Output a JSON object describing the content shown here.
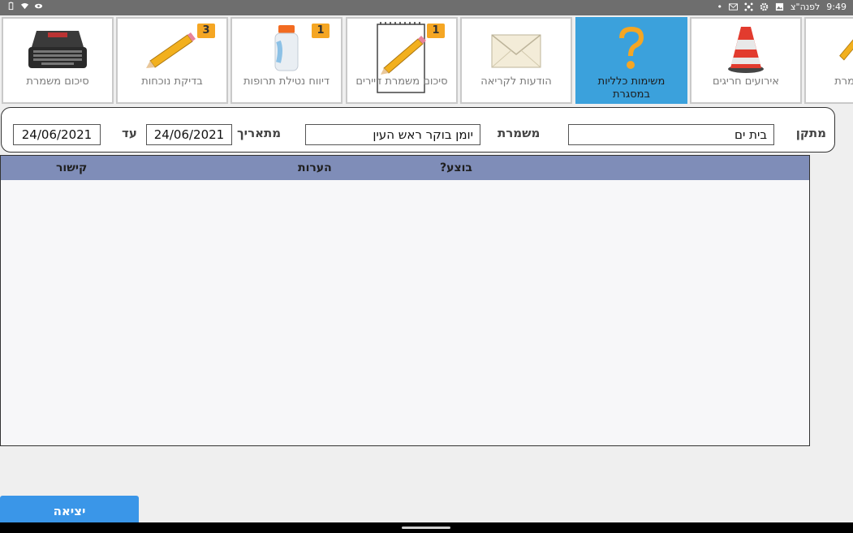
{
  "statusbar": {
    "time": "9:49",
    "day": "לפנה\"צ",
    "icons": [
      "dot-icon",
      "gmail-icon",
      "network-icon",
      "settings-icon",
      "image-icon"
    ],
    "left_icons": [
      "battery-icon",
      "wifi-icon",
      "eye-icon"
    ]
  },
  "tiles": [
    {
      "label": "משמרת",
      "icon": "partial-pencil-icon"
    },
    {
      "label": "אירועים חריגים",
      "icon": "traffic-cone-icon"
    },
    {
      "label": "משימות כלליות במסגרת",
      "icon": "question-mark-icon",
      "active": true
    },
    {
      "label": "הודעות לקריאה",
      "icon": "envelope-icon"
    },
    {
      "label": "סיכום משמרת דיירים",
      "icon": "notepad-pencil-icon",
      "badge": "1"
    },
    {
      "label": "דיווח נטילת תרופות",
      "icon": "pill-bottle-icon",
      "badge": "1"
    },
    {
      "label": "בדיקת נוכחות",
      "icon": "pencil-icon",
      "badge": "3"
    },
    {
      "label": "סיכום משמרת",
      "icon": "typewriter-icon"
    }
  ],
  "filter": {
    "facility_label": "מתקן",
    "facility_value": "בית ים",
    "shift_label": "משמרת",
    "shift_value": "יומן בוקר ראש העין",
    "from_label": "מתאריך",
    "from_value": "24/06/2021",
    "to_label": "עד",
    "to_value": "24/06/2021"
  },
  "table": {
    "columns": [
      "בוצע?",
      "הערות",
      "קישור"
    ],
    "rows": []
  },
  "exit_label": "יציאה",
  "colors": {
    "active_tile": "#3ba1dc",
    "header": "#7f8db8",
    "badge": "#f5a623",
    "exit": "#3a96e8"
  }
}
